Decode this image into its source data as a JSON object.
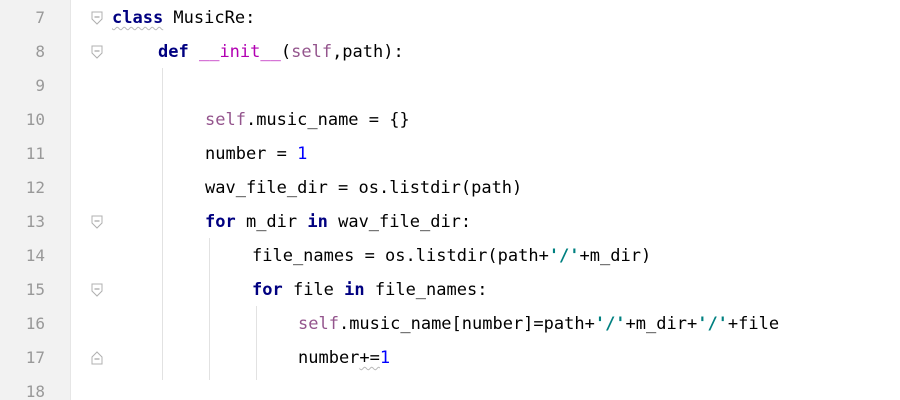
{
  "gutter": {
    "line_numbers": [
      "7",
      "8",
      "9",
      "10",
      "11",
      "12",
      "13",
      "14",
      "15",
      "16",
      "17",
      "18"
    ],
    "fold_markers": [
      {
        "line": "7",
        "icon": "fold-open-icon"
      },
      {
        "line": "8",
        "icon": "fold-open-icon"
      },
      {
        "line": "13",
        "icon": "fold-open-icon"
      },
      {
        "line": "15",
        "icon": "fold-open-icon"
      },
      {
        "line": "17",
        "icon": "fold-close-icon"
      }
    ]
  },
  "code": {
    "line7": {
      "kw": "class",
      "rest": " MusicRe:"
    },
    "line8": {
      "kw": "def",
      "sp": " ",
      "fn": "__init__",
      "open": "(",
      "self": "self",
      "rest": ",path):"
    },
    "line10": {
      "self": "self",
      "rest": ".music_name = {}"
    },
    "line11": {
      "rest": "number = ",
      "num": "1"
    },
    "line12": {
      "rest": "wav_file_dir = os.listdir(path)"
    },
    "line13": {
      "kw": "for",
      "mid": " m_dir ",
      "kw2": "in",
      "rest": " wav_file_dir:"
    },
    "line14": {
      "rest": "file_names = os.listdir(path+",
      "str": "'/'",
      "rest2": "+m_dir)"
    },
    "line15": {
      "kw": "for",
      "mid": " file ",
      "kw2": "in",
      "rest": " file_names:"
    },
    "line16": {
      "self": "self",
      "rest": ".music_name[number]=path+",
      "str1": "'/'",
      "mid": "+m_dir+",
      "str2": "'/'",
      "rest2": "+file"
    },
    "line17": {
      "rest": "number",
      "op": "+=",
      "num": "1"
    }
  },
  "colors": {
    "keyword": "#000080",
    "self": "#94558d",
    "number": "#0000ff",
    "string": "#008080",
    "gutter_bg": "#f2f2f2",
    "line_number": "#999999"
  }
}
